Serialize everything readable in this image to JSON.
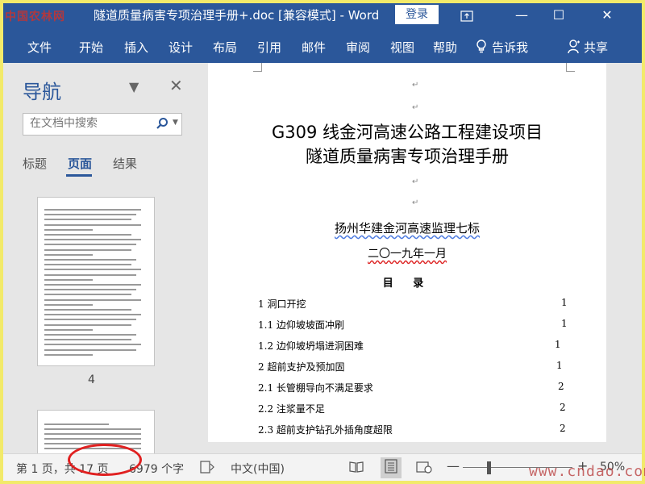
{
  "watermark_top": "中国农林网",
  "window": {
    "title": "隧道质量病害专项治理手册+.doc [兼容模式]  -  Word",
    "login_label": "登录",
    "restore_icon": "ribbon-display-icon",
    "minimize": "—",
    "maximize": "☐",
    "close": "✕"
  },
  "menu": {
    "items": [
      "文件",
      "开始",
      "插入",
      "设计",
      "布局",
      "引用",
      "邮件",
      "审阅",
      "视图",
      "帮助"
    ],
    "tell_me": "告诉我",
    "share": "共享"
  },
  "nav_pane": {
    "title": "导航",
    "search_placeholder": "在文档中搜索",
    "tabs": [
      "标题",
      "页面",
      "结果"
    ],
    "active_tab": "页面",
    "thumbnail_page": "4"
  },
  "document": {
    "title_line1": "G309 线金河高速公路工程建设项目",
    "title_line2": "隧道质量病害专项治理手册",
    "company": "扬州华建金河高速监理七标",
    "date": "二〇一九年一月",
    "toc_heading": "目  录",
    "toc": [
      {
        "text": "1 洞口开挖",
        "page": "1"
      },
      {
        "text": "1.1 边仰坡坡面冲刷",
        "page": "1"
      },
      {
        "text": "1.2 边仰坡坍塌进洞困难",
        "page": "1"
      },
      {
        "text": "2 超前支护及预加固",
        "page": "1"
      },
      {
        "text": "2.1 长管棚导向不满足要求",
        "page": "2"
      },
      {
        "text": "2.2 注浆量不足",
        "page": "2"
      },
      {
        "text": "2.3 超前支护钻孔外插角度超限",
        "page": "2"
      }
    ]
  },
  "status": {
    "page_info": "第 1 页，共 17 页",
    "word_count": "6979 个字",
    "language": "中文(中国)",
    "zoom": "50%",
    "zoom_level": 0.5
  },
  "watermark_bottom": "www.cndao.com"
}
